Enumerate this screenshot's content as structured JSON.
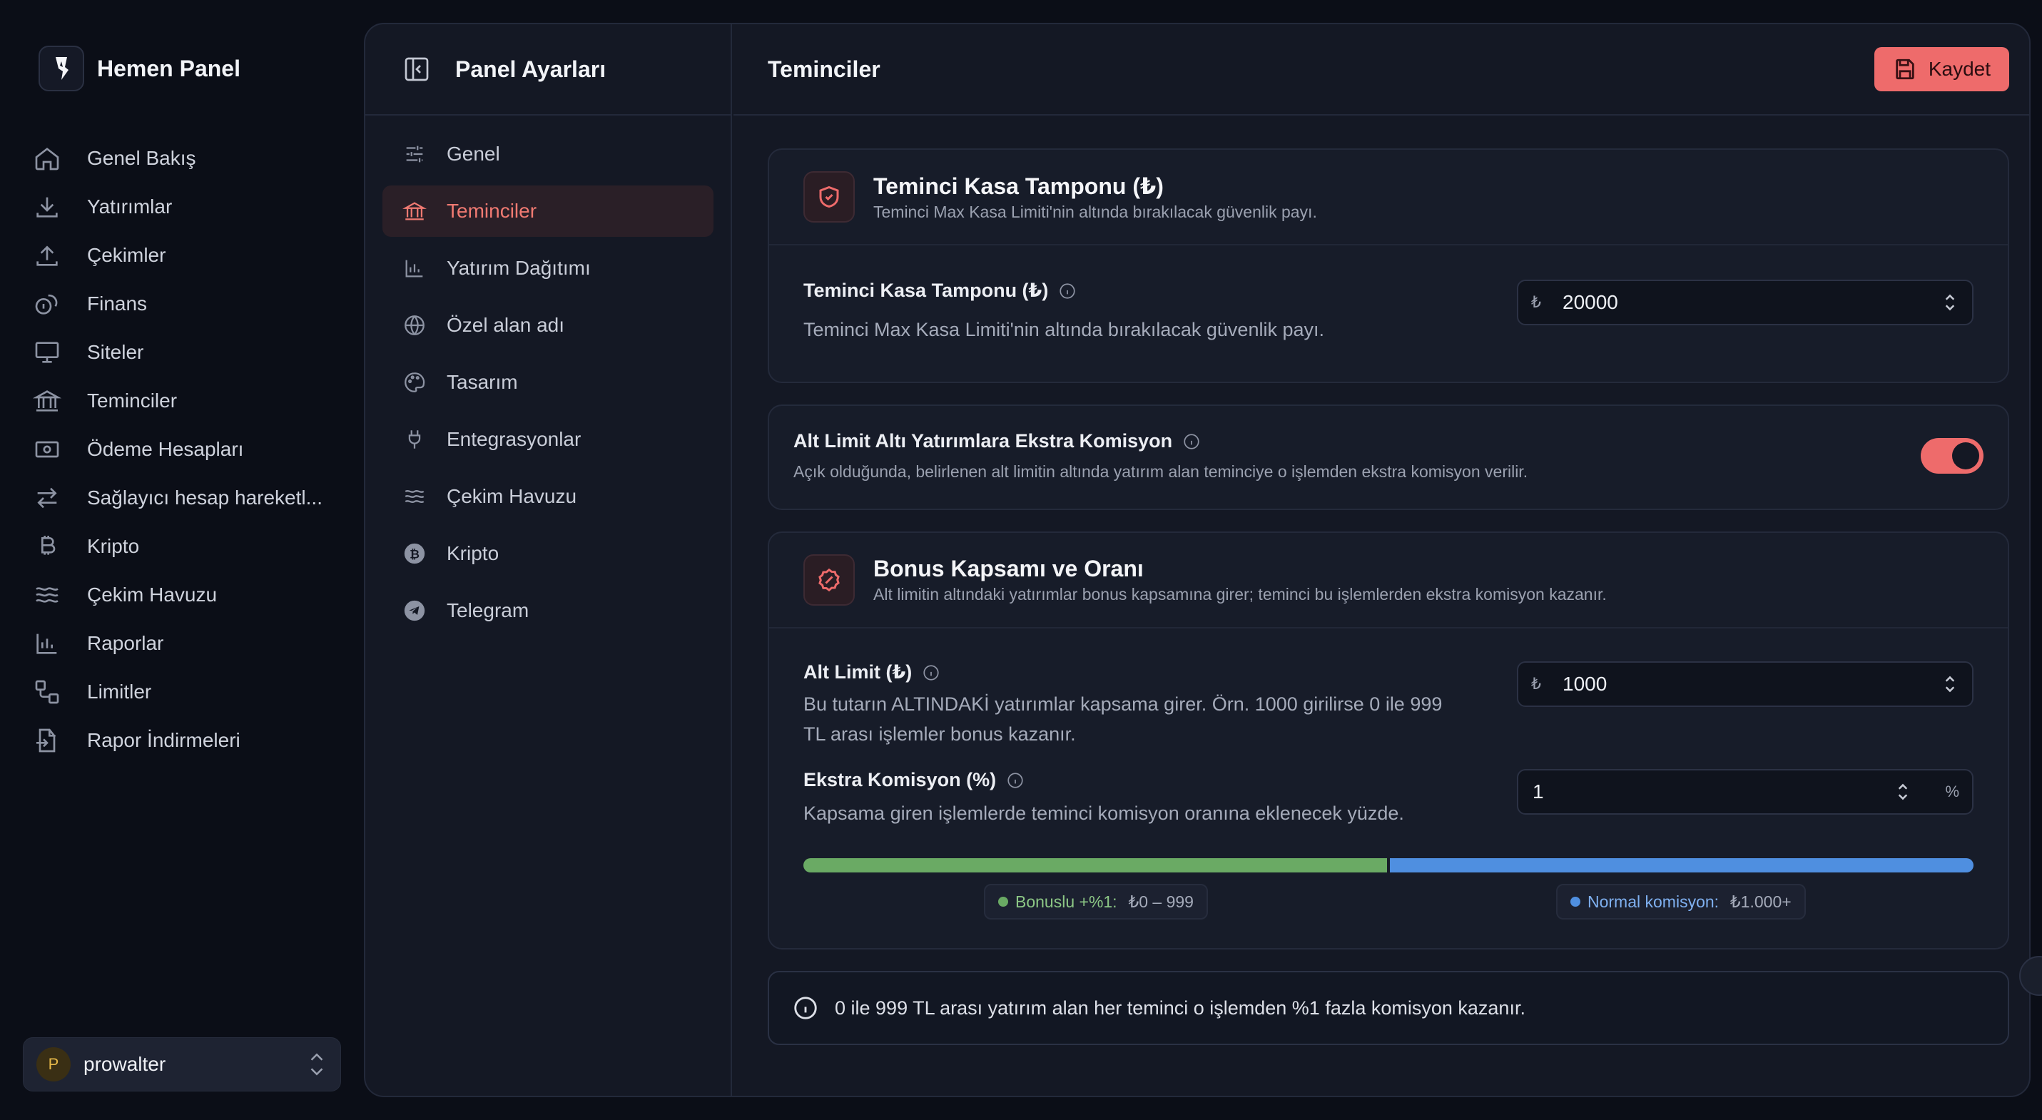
{
  "brand": {
    "name": "Hemen Panel"
  },
  "nav": [
    {
      "label": "Genel Bakış",
      "icon": "home-icon"
    },
    {
      "label": "Yatırımlar",
      "icon": "download-icon"
    },
    {
      "label": "Çekimler",
      "icon": "upload-icon"
    },
    {
      "label": "Finans",
      "icon": "coins-icon"
    },
    {
      "label": "Siteler",
      "icon": "monitor-icon"
    },
    {
      "label": "Teminciler",
      "icon": "bank-icon"
    },
    {
      "label": "Ödeme Hesapları",
      "icon": "banknote-icon"
    },
    {
      "label": "Sağlayıcı hesap hareketl...",
      "icon": "arrows-swap-icon"
    },
    {
      "label": "Kripto",
      "icon": "bitcoin-icon"
    },
    {
      "label": "Çekim Havuzu",
      "icon": "waves-icon"
    },
    {
      "label": "Raporlar",
      "icon": "bar-chart-icon"
    },
    {
      "label": "Limitler",
      "icon": "workflow-icon"
    },
    {
      "label": "Rapor İndirmeleri",
      "icon": "file-export-icon"
    }
  ],
  "user": {
    "initial": "P",
    "name": "prowalter"
  },
  "settings": {
    "title": "Panel Ayarları",
    "items": [
      {
        "label": "Genel",
        "icon": "sliders-icon"
      },
      {
        "label": "Teminciler",
        "icon": "bank-icon",
        "active": true
      },
      {
        "label": "Yatırım Dağıtımı",
        "icon": "bar-chart-icon"
      },
      {
        "label": "Özel alan adı",
        "icon": "globe-icon"
      },
      {
        "label": "Tasarım",
        "icon": "palette-icon"
      },
      {
        "label": "Entegrasyonlar",
        "icon": "plug-icon"
      },
      {
        "label": "Çekim Havuzu",
        "icon": "waves-icon"
      },
      {
        "label": "Kripto",
        "icon": "bitcoin-icon"
      },
      {
        "label": "Telegram",
        "icon": "telegram-icon"
      }
    ]
  },
  "content": {
    "title": "Teminciler",
    "save_label": "Kaydet",
    "buffer_card": {
      "title": "Teminci Kasa Tamponu (₺)",
      "subtitle": "Teminci Max Kasa Limiti'nin altında bırakılacak güvenlik payı.",
      "field_label": "Teminci Kasa Tamponu (₺)",
      "field_desc": "Teminci Max Kasa Limiti'nin altında bırakılacak güvenlik payı.",
      "currency": "₺",
      "value": "20000"
    },
    "toggle_card": {
      "title": "Alt Limit Altı Yatırımlara Ekstra Komisyon",
      "desc": "Açık olduğunda, belirlenen alt limitin altında yatırım alan teminciye o işlemden ekstra komisyon verilir.",
      "enabled": true
    },
    "bonus_card": {
      "title": "Bonus Kapsamı ve Oranı",
      "subtitle": "Alt limitin altındaki yatırımlar bonus kapsamına girer; teminci bu işlemlerden ekstra komisyon kazanır.",
      "limit_label": "Alt Limit (₺)",
      "limit_desc": "Bu tutarın ALTINDAKİ yatırımlar kapsama girer. Örn. 1000 girilirse 0 ile 999 TL arası işlemler bonus kazanır.",
      "limit_currency": "₺",
      "limit_value": "1000",
      "commission_label": "Ekstra Komisyon (%)",
      "commission_desc": "Kapsama giren işlemlerde teminci komisyon oranına eklenecek yüzde.",
      "commission_value": "1",
      "commission_unit": "%",
      "bar": {
        "bonus_fraction": 0.5
      },
      "legend_bonus_key": "Bonuslu +%1:",
      "legend_bonus_range": "₺0 – 999",
      "legend_normal_key": "Normal komisyon:",
      "legend_normal_range": "₺1.000+",
      "colors": {
        "bonus": "#6aaa64",
        "normal": "#4f8fe0",
        "accent": "#ee6b6b"
      }
    },
    "notice": "0 ile 999 TL arası yatırım alan her teminci o işlemden %1 fazla komisyon kazanır."
  }
}
